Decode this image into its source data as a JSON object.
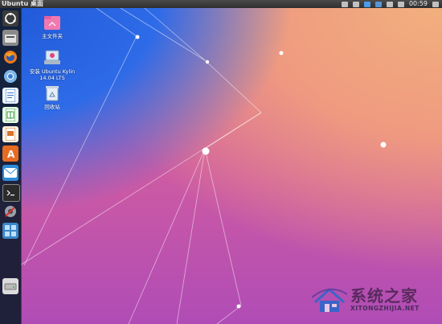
{
  "top_panel": {
    "title": "Ubuntu 桌面",
    "time": "00:59"
  },
  "launcher": {
    "items": [
      {
        "name": "dash-home",
        "icon": "ubuntu-logo-icon"
      },
      {
        "name": "files",
        "icon": "folder-icon"
      },
      {
        "name": "firefox",
        "icon": "firefox-icon"
      },
      {
        "name": "chromium",
        "icon": "chromium-icon"
      },
      {
        "name": "writer",
        "icon": "document-icon"
      },
      {
        "name": "calc",
        "icon": "spreadsheet-icon"
      },
      {
        "name": "impress",
        "icon": "presentation-icon"
      },
      {
        "name": "software-center",
        "icon": "software-center-icon"
      },
      {
        "name": "mail",
        "icon": "mail-icon"
      },
      {
        "name": "terminal",
        "icon": "terminal-icon"
      },
      {
        "name": "settings",
        "icon": "settings-icon"
      },
      {
        "name": "workspaces",
        "icon": "workspace-icon"
      },
      {
        "name": "drive",
        "icon": "drive-icon"
      }
    ]
  },
  "desktop_icons": [
    {
      "label": "主文件夹",
      "icon": "home-folder-icon"
    },
    {
      "label": "安装 Ubuntu Kylin 14.04 LTS",
      "icon": "installer-icon"
    },
    {
      "label": "回收站",
      "icon": "trash-icon"
    }
  ],
  "watermark": {
    "title": "系统之家",
    "subtitle": "XITONGZHIJIA.NET"
  },
  "colors": {
    "launcher_bg": "#121c30",
    "panel_bg": "#2f2f2f",
    "watermark": "#5a2a5e"
  }
}
